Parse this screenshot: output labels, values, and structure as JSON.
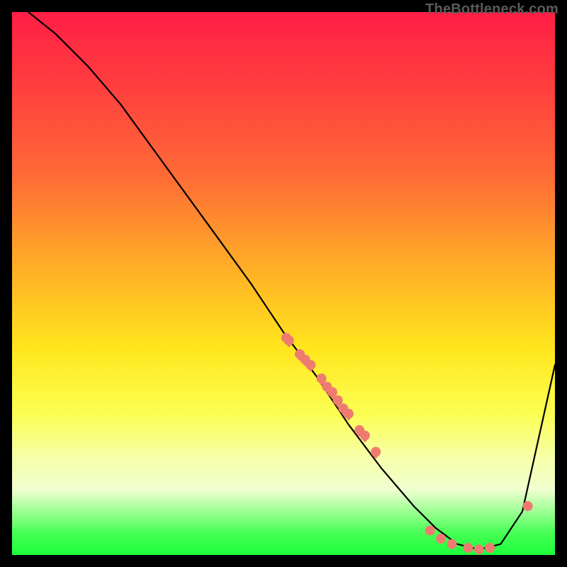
{
  "watermark": "TheBottleneck.com",
  "chart_data": {
    "type": "line",
    "title": "",
    "xlabel": "",
    "ylabel": "",
    "xlim": [
      0,
      100
    ],
    "ylim": [
      0,
      100
    ],
    "curve": {
      "name": "bottleneck-curve",
      "x": [
        3,
        8,
        14,
        20,
        28,
        36,
        44,
        50,
        56,
        62,
        68,
        74,
        78,
        82,
        86,
        90,
        94,
        100
      ],
      "y": [
        100,
        96,
        90,
        83,
        72,
        61,
        50,
        41,
        33,
        24,
        16,
        9,
        5,
        2,
        1,
        2,
        8,
        35
      ]
    },
    "points": {
      "name": "highlighted-points",
      "color": "#ef7b70",
      "x": [
        50.5,
        51,
        53,
        54,
        55,
        57,
        58,
        59,
        60,
        61,
        62,
        64,
        65,
        67,
        77,
        79,
        81,
        84,
        86,
        88,
        95
      ],
      "y": [
        40,
        39.5,
        37,
        36,
        35,
        32.5,
        31,
        30,
        28.5,
        27,
        26,
        23,
        22,
        19,
        4.5,
        3,
        2,
        1.3,
        1,
        1.3,
        9
      ]
    },
    "gradient_stops": [
      {
        "pos": 0,
        "color": "#ff1e46"
      },
      {
        "pos": 30,
        "color": "#ff6a36"
      },
      {
        "pos": 62,
        "color": "#ffe61d"
      },
      {
        "pos": 88,
        "color": "#f0ffd0"
      },
      {
        "pos": 100,
        "color": "#1aff3a"
      }
    ]
  }
}
